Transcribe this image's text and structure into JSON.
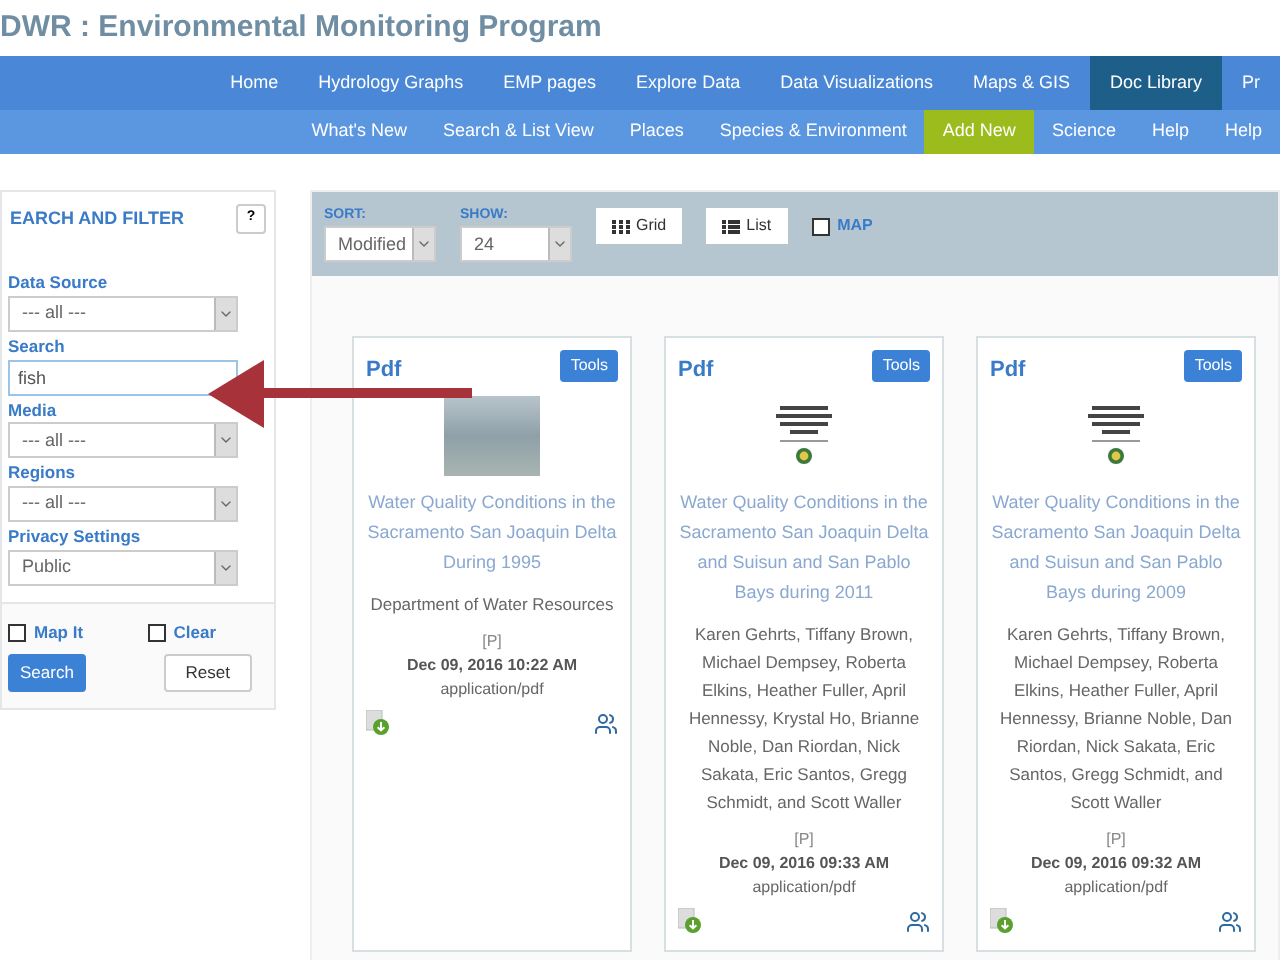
{
  "title": "DWR : Environmental Monitoring Program",
  "nav_primary": [
    {
      "label": "Home",
      "selected": false
    },
    {
      "label": "Hydrology Graphs",
      "selected": false
    },
    {
      "label": "EMP pages",
      "selected": false
    },
    {
      "label": "Explore Data",
      "selected": false
    },
    {
      "label": "Data Visualizations",
      "selected": false
    },
    {
      "label": "Maps & GIS",
      "selected": false
    },
    {
      "label": "Doc Library",
      "selected": true
    },
    {
      "label": "Pr",
      "selected": false
    }
  ],
  "nav_secondary": [
    {
      "label": "What's New",
      "selected": false
    },
    {
      "label": "Search & List View",
      "selected": false
    },
    {
      "label": "Places",
      "selected": false
    },
    {
      "label": "Species & Environment",
      "selected": false
    },
    {
      "label": "Add New",
      "selected": true
    },
    {
      "label": "Science",
      "selected": false
    },
    {
      "label": "Help",
      "selected": false
    },
    {
      "label": "Help",
      "selected": false
    }
  ],
  "sidebar": {
    "heading": "EARCH AND FILTER",
    "help": "?",
    "fields": [
      {
        "kind": "select",
        "label": "Data Source",
        "value": "--- all ---"
      },
      {
        "kind": "text",
        "label": "Search",
        "value": "fish"
      },
      {
        "kind": "select",
        "label": "Media",
        "value": "--- all ---"
      },
      {
        "kind": "select",
        "label": "Regions",
        "value": "--- all ---"
      },
      {
        "kind": "select",
        "label": "Privacy Settings",
        "value": "Public"
      }
    ],
    "map_it": {
      "label": "Map It",
      "checked": false
    },
    "clear": {
      "label": "Clear",
      "checked": false
    },
    "search_button": "Search",
    "reset_button": "Reset"
  },
  "toolbar": {
    "sort": {
      "label": "SORT:",
      "value": "Modified"
    },
    "show": {
      "label": "SHOW:",
      "value": "24"
    },
    "grid_button": "Grid",
    "list_button": "List",
    "map": {
      "label": "MAP",
      "checked": false
    }
  },
  "cards": [
    {
      "kind": "photo",
      "type": "Pdf",
      "tools": "Tools",
      "title": "Water Quality Conditions in the Sacramento San Joaquin Delta During 1995",
      "authors": "Department of Water Resources",
      "privacy": "[P]",
      "date": "Dec 09, 2016 10:22 AM",
      "mime": "application/pdf"
    },
    {
      "kind": "document",
      "type": "Pdf",
      "tools": "Tools",
      "title": "Water Quality Conditions in the Sacramento San Joaquin Delta and Suisun and San Pablo Bays during 2011",
      "authors": "Karen Gehrts, Tiffany Brown, Michael Dempsey, Roberta Elkins, Heather Fuller, April Hennessy, Krystal Ho, Brianne Noble, Dan Riordan, Nick Sakata, Eric Santos, Gregg Schmidt, and Scott Waller",
      "privacy": "[P]",
      "date": "Dec 09, 2016 09:33 AM",
      "mime": "application/pdf"
    },
    {
      "kind": "document",
      "type": "Pdf",
      "tools": "Tools",
      "title": "Water Quality Conditions in the Sacramento San Joaquin Delta and Suisun and San Pablo Bays during 2009",
      "authors": "Karen Gehrts, Tiffany Brown, Michael Dempsey, Roberta Elkins, Heather Fuller, April Hennessy, Brianne Noble, Dan Riordan, Nick Sakata, Eric Santos, Gregg Schmidt, and Scott Waller",
      "privacy": "[P]",
      "date": "Dec 09, 2016 09:32 AM",
      "mime": "application/pdf"
    }
  ]
}
